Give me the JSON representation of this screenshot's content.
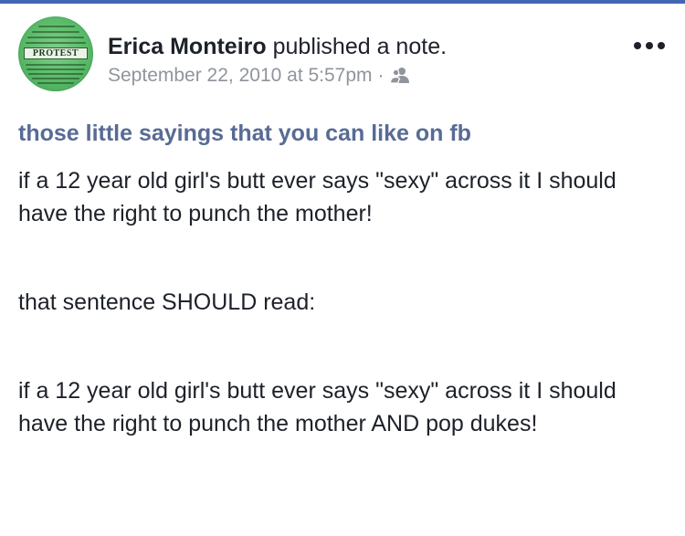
{
  "post": {
    "author_name": "Erica Monteiro",
    "action": "published a note.",
    "timestamp": "September 22, 2010 at 5:57pm",
    "separator": "·",
    "audience_icon": "friends-icon",
    "more_icon": "more-options-icon",
    "avatar_text": "PROTEST"
  },
  "note": {
    "title": "those little sayings that you can like on fb",
    "paragraphs": [
      "if a 12 year old girl's butt ever says \"sexy\" across it I should have the right to punch the mother!",
      "that sentence SHOULD read:",
      "if a 12 year old girl's butt ever says \"sexy\" across it I should have the right to punch the mother AND pop dukes!"
    ]
  },
  "colors": {
    "link": "#576b95",
    "meta": "#90949c",
    "text": "#1d2129",
    "avatar_green": "#56b866"
  }
}
